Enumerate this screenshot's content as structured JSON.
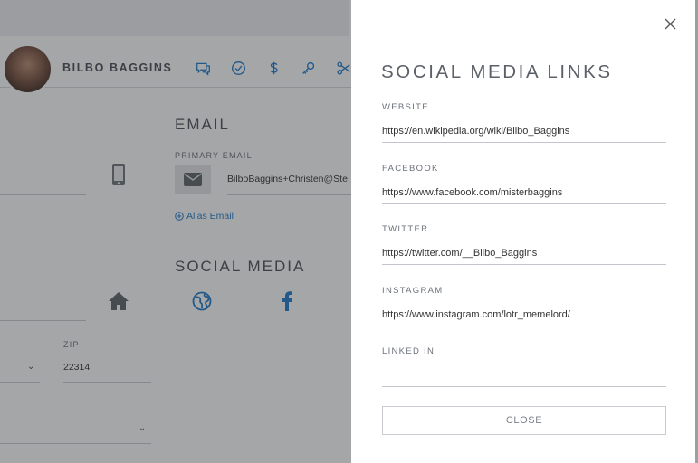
{
  "background": {
    "contact": {
      "name": "BILBO BAGGINS"
    },
    "header_icons": [
      "chat-icon",
      "check-circle-icon",
      "dollar-icon",
      "key-icon",
      "scissors-icon"
    ],
    "email_section": {
      "title": "EMAIL",
      "primary_label": "PRIMARY EMAIL",
      "primary_value": "BilboBaggins+Christen@Ste",
      "alias_link": "Alias Email"
    },
    "social_section": {
      "title": "SOCIAL MEDIA",
      "icons": [
        "home-icon",
        "globe-icon",
        "facebook-icon"
      ]
    },
    "address": {
      "zip_label": "ZIP",
      "zip_value": "22314"
    }
  },
  "panel": {
    "title": "SOCIAL MEDIA LINKS",
    "fields": [
      {
        "label": "WEBSITE",
        "value": "https://en.wikipedia.org/wiki/Bilbo_Baggins"
      },
      {
        "label": "FACEBOOK",
        "value": "https://www.facebook.com/misterbaggins"
      },
      {
        "label": "TWITTER",
        "value": "https://twitter.com/__Bilbo_Baggins"
      },
      {
        "label": "INSTAGRAM",
        "value": "https://www.instagram.com/lotr_memelord/"
      },
      {
        "label": "LINKED IN",
        "value": ""
      }
    ],
    "close_button": "CLOSE"
  },
  "colors": {
    "accent": "#1f7acc",
    "overlay": "rgba(40,42,46,0.42)",
    "panel_bg": "#ffffff"
  }
}
